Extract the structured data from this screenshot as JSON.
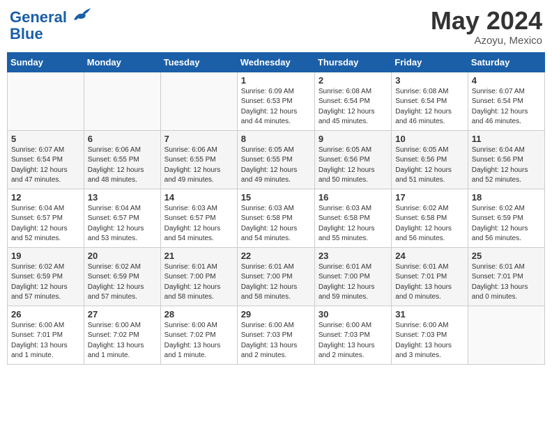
{
  "header": {
    "logo": {
      "line1": "General",
      "line2": "Blue"
    },
    "title": "May 2024",
    "location": "Azoyu, Mexico"
  },
  "weekdays": [
    "Sunday",
    "Monday",
    "Tuesday",
    "Wednesday",
    "Thursday",
    "Friday",
    "Saturday"
  ],
  "weeks": [
    [
      {
        "day": "",
        "info": ""
      },
      {
        "day": "",
        "info": ""
      },
      {
        "day": "",
        "info": ""
      },
      {
        "day": "1",
        "info": "Sunrise: 6:09 AM\nSunset: 6:53 PM\nDaylight: 12 hours\nand 44 minutes."
      },
      {
        "day": "2",
        "info": "Sunrise: 6:08 AM\nSunset: 6:54 PM\nDaylight: 12 hours\nand 45 minutes."
      },
      {
        "day": "3",
        "info": "Sunrise: 6:08 AM\nSunset: 6:54 PM\nDaylight: 12 hours\nand 46 minutes."
      },
      {
        "day": "4",
        "info": "Sunrise: 6:07 AM\nSunset: 6:54 PM\nDaylight: 12 hours\nand 46 minutes."
      }
    ],
    [
      {
        "day": "5",
        "info": "Sunrise: 6:07 AM\nSunset: 6:54 PM\nDaylight: 12 hours\nand 47 minutes."
      },
      {
        "day": "6",
        "info": "Sunrise: 6:06 AM\nSunset: 6:55 PM\nDaylight: 12 hours\nand 48 minutes."
      },
      {
        "day": "7",
        "info": "Sunrise: 6:06 AM\nSunset: 6:55 PM\nDaylight: 12 hours\nand 49 minutes."
      },
      {
        "day": "8",
        "info": "Sunrise: 6:05 AM\nSunset: 6:55 PM\nDaylight: 12 hours\nand 49 minutes."
      },
      {
        "day": "9",
        "info": "Sunrise: 6:05 AM\nSunset: 6:56 PM\nDaylight: 12 hours\nand 50 minutes."
      },
      {
        "day": "10",
        "info": "Sunrise: 6:05 AM\nSunset: 6:56 PM\nDaylight: 12 hours\nand 51 minutes."
      },
      {
        "day": "11",
        "info": "Sunrise: 6:04 AM\nSunset: 6:56 PM\nDaylight: 12 hours\nand 52 minutes."
      }
    ],
    [
      {
        "day": "12",
        "info": "Sunrise: 6:04 AM\nSunset: 6:57 PM\nDaylight: 12 hours\nand 52 minutes."
      },
      {
        "day": "13",
        "info": "Sunrise: 6:04 AM\nSunset: 6:57 PM\nDaylight: 12 hours\nand 53 minutes."
      },
      {
        "day": "14",
        "info": "Sunrise: 6:03 AM\nSunset: 6:57 PM\nDaylight: 12 hours\nand 54 minutes."
      },
      {
        "day": "15",
        "info": "Sunrise: 6:03 AM\nSunset: 6:58 PM\nDaylight: 12 hours\nand 54 minutes."
      },
      {
        "day": "16",
        "info": "Sunrise: 6:03 AM\nSunset: 6:58 PM\nDaylight: 12 hours\nand 55 minutes."
      },
      {
        "day": "17",
        "info": "Sunrise: 6:02 AM\nSunset: 6:58 PM\nDaylight: 12 hours\nand 56 minutes."
      },
      {
        "day": "18",
        "info": "Sunrise: 6:02 AM\nSunset: 6:59 PM\nDaylight: 12 hours\nand 56 minutes."
      }
    ],
    [
      {
        "day": "19",
        "info": "Sunrise: 6:02 AM\nSunset: 6:59 PM\nDaylight: 12 hours\nand 57 minutes."
      },
      {
        "day": "20",
        "info": "Sunrise: 6:02 AM\nSunset: 6:59 PM\nDaylight: 12 hours\nand 57 minutes."
      },
      {
        "day": "21",
        "info": "Sunrise: 6:01 AM\nSunset: 7:00 PM\nDaylight: 12 hours\nand 58 minutes."
      },
      {
        "day": "22",
        "info": "Sunrise: 6:01 AM\nSunset: 7:00 PM\nDaylight: 12 hours\nand 58 minutes."
      },
      {
        "day": "23",
        "info": "Sunrise: 6:01 AM\nSunset: 7:00 PM\nDaylight: 12 hours\nand 59 minutes."
      },
      {
        "day": "24",
        "info": "Sunrise: 6:01 AM\nSunset: 7:01 PM\nDaylight: 13 hours\nand 0 minutes."
      },
      {
        "day": "25",
        "info": "Sunrise: 6:01 AM\nSunset: 7:01 PM\nDaylight: 13 hours\nand 0 minutes."
      }
    ],
    [
      {
        "day": "26",
        "info": "Sunrise: 6:00 AM\nSunset: 7:01 PM\nDaylight: 13 hours\nand 1 minute."
      },
      {
        "day": "27",
        "info": "Sunrise: 6:00 AM\nSunset: 7:02 PM\nDaylight: 13 hours\nand 1 minute."
      },
      {
        "day": "28",
        "info": "Sunrise: 6:00 AM\nSunset: 7:02 PM\nDaylight: 13 hours\nand 1 minute."
      },
      {
        "day": "29",
        "info": "Sunrise: 6:00 AM\nSunset: 7:03 PM\nDaylight: 13 hours\nand 2 minutes."
      },
      {
        "day": "30",
        "info": "Sunrise: 6:00 AM\nSunset: 7:03 PM\nDaylight: 13 hours\nand 2 minutes."
      },
      {
        "day": "31",
        "info": "Sunrise: 6:00 AM\nSunset: 7:03 PM\nDaylight: 13 hours\nand 3 minutes."
      },
      {
        "day": "",
        "info": ""
      }
    ]
  ]
}
